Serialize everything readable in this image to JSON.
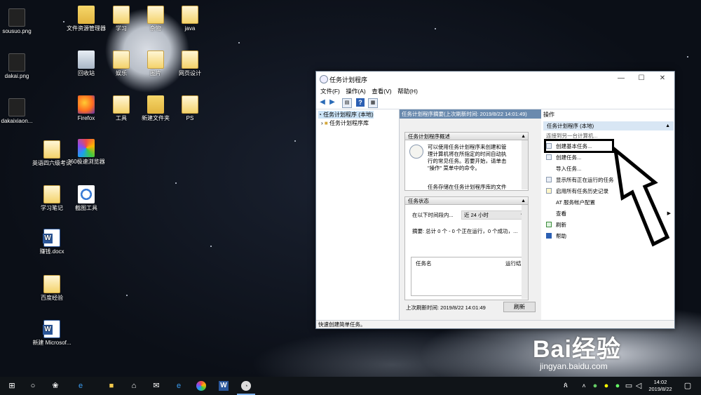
{
  "desktop": {
    "icons": [
      {
        "label": "sousuo.png",
        "icon": "png-file-icon"
      },
      {
        "label": "dakai.png",
        "icon": "png-file-icon"
      },
      {
        "label": "dakaixiaon...",
        "icon": "png-file-icon"
      },
      {
        "label": "文件资源管理器",
        "icon": "file-explorer-icon"
      },
      {
        "label": "回收站",
        "icon": "recycle-bin-icon"
      },
      {
        "label": "Firefox",
        "icon": "firefox-icon"
      },
      {
        "label": "英语四六级考试",
        "icon": "document-icon"
      },
      {
        "label": "360极速浏览器",
        "icon": "browser-360-icon"
      },
      {
        "label": "学习笔记",
        "icon": "document-icon"
      },
      {
        "label": "截图工具",
        "icon": "snipping-tool-icon"
      },
      {
        "label": "赚钱.docx",
        "icon": "word-document-icon"
      },
      {
        "label": "百度经验",
        "icon": "document-icon"
      },
      {
        "label": "新建 Microsof...",
        "icon": "word-document-icon"
      },
      {
        "label": "学习",
        "icon": "document-icon"
      },
      {
        "label": "娱乐",
        "icon": "document-icon"
      },
      {
        "label": "工具",
        "icon": "document-icon"
      },
      {
        "label": "杂物",
        "icon": "document-icon"
      },
      {
        "label": "图片",
        "icon": "document-icon"
      },
      {
        "label": "新建文件夹",
        "icon": "folder-icon"
      },
      {
        "label": "java",
        "icon": "document-icon"
      },
      {
        "label": "网页设计",
        "icon": "document-icon"
      },
      {
        "label": "PS",
        "icon": "document-icon"
      }
    ]
  },
  "window": {
    "title": "任务计划程序",
    "controls": {
      "minimize": "—",
      "maximize": "☐",
      "close": "✕"
    },
    "menu": [
      "文件(F)",
      "操作(A)",
      "查看(V)",
      "帮助(H)"
    ],
    "tree": {
      "root": "任务计划程序 (本地)",
      "child": "任务计划程序库"
    },
    "center": {
      "header": "任务计划程序摘要(上次刷新时间: 2019/8/22 14:01:49)",
      "overview_title": "任务计划程序概述",
      "overview_text": [
        "可以使用任务计划程序来创建和管",
        "理计算机将在所指定的时间自动执",
        "行的常见任务。若要开始，请单击",
        "\"操作\" 菜单中的命令。",
        "任务存储在任务计划程序库的文件"
      ],
      "status_title": "任务状态",
      "status_period_label": "在以下时间段内...",
      "status_period_value": "近 24 小时",
      "summary": "摘要: 总计 0 个 - 0 个正在运行，0 个成功，...",
      "table_headers": [
        "任务名",
        "运行结果"
      ],
      "last_refresh": "上次刷新时间: 2019/8/22 14:01:49",
      "refresh_button": "刷新"
    },
    "actions": {
      "title": "操作",
      "subheader": "任务计划程序 (本地)",
      "items": [
        "连接到另一台计算机...",
        "创建基本任务...",
        "创建任务...",
        "导入任务...",
        "显示所有正在运行的任务",
        "启用所有任务历史记录",
        "AT 服务帐户配置",
        "查看",
        "刷新",
        "帮助"
      ]
    },
    "status_bar": "快速创建简单任务。"
  },
  "taskbar": {
    "time": "14:02",
    "date": "2019/8/22"
  },
  "watermark": {
    "brand": "Bai经验",
    "url": "jingyan.baidu.com"
  }
}
